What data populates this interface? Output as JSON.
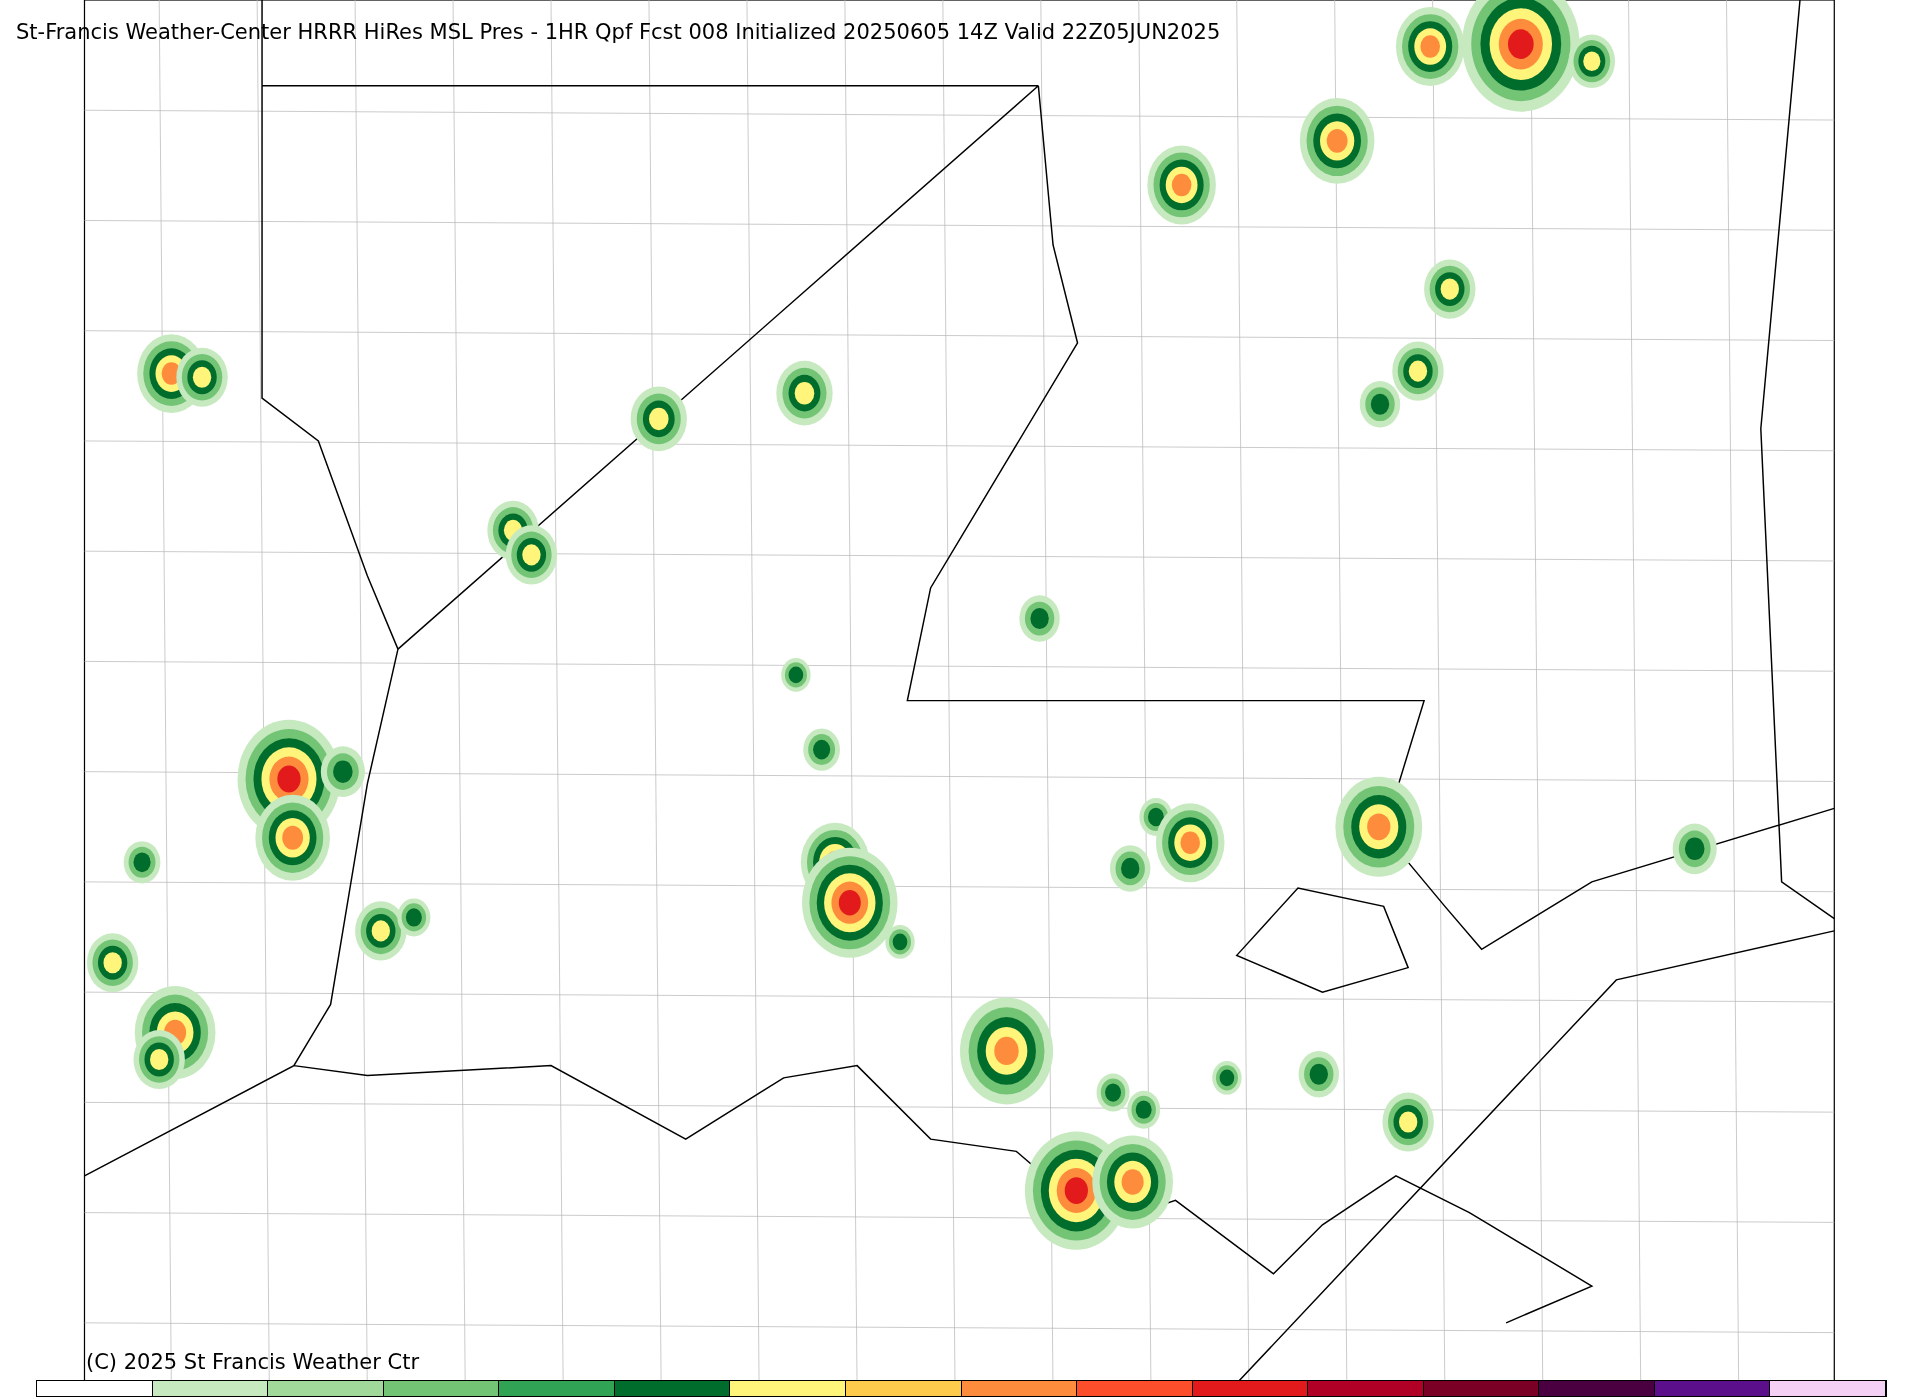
{
  "title": "St-Francis Weather-Center HRRR HiRes MSL Pres - 1HR Qpf Fcst 008 Initialized 20250605 14Z Valid 22Z05JUN2025",
  "copyright": "(C) 2025 St Francis Weather Ctr",
  "colorbar": [
    {
      "color": "#ffffff"
    },
    {
      "color": "#c7e9c0"
    },
    {
      "color": "#a1d99b"
    },
    {
      "color": "#74c476"
    },
    {
      "color": "#31a354"
    },
    {
      "color": "#006d2c"
    },
    {
      "color": "#fff57a"
    },
    {
      "color": "#ffcb4d"
    },
    {
      "color": "#fd8d3c"
    },
    {
      "color": "#fc4e2a"
    },
    {
      "color": "#e31a1c"
    },
    {
      "color": "#b10026"
    },
    {
      "color": "#7a0026"
    },
    {
      "color": "#4a0040"
    },
    {
      "color": "#5c0f8b"
    },
    {
      "color": "#f5d0f5"
    }
  ]
}
